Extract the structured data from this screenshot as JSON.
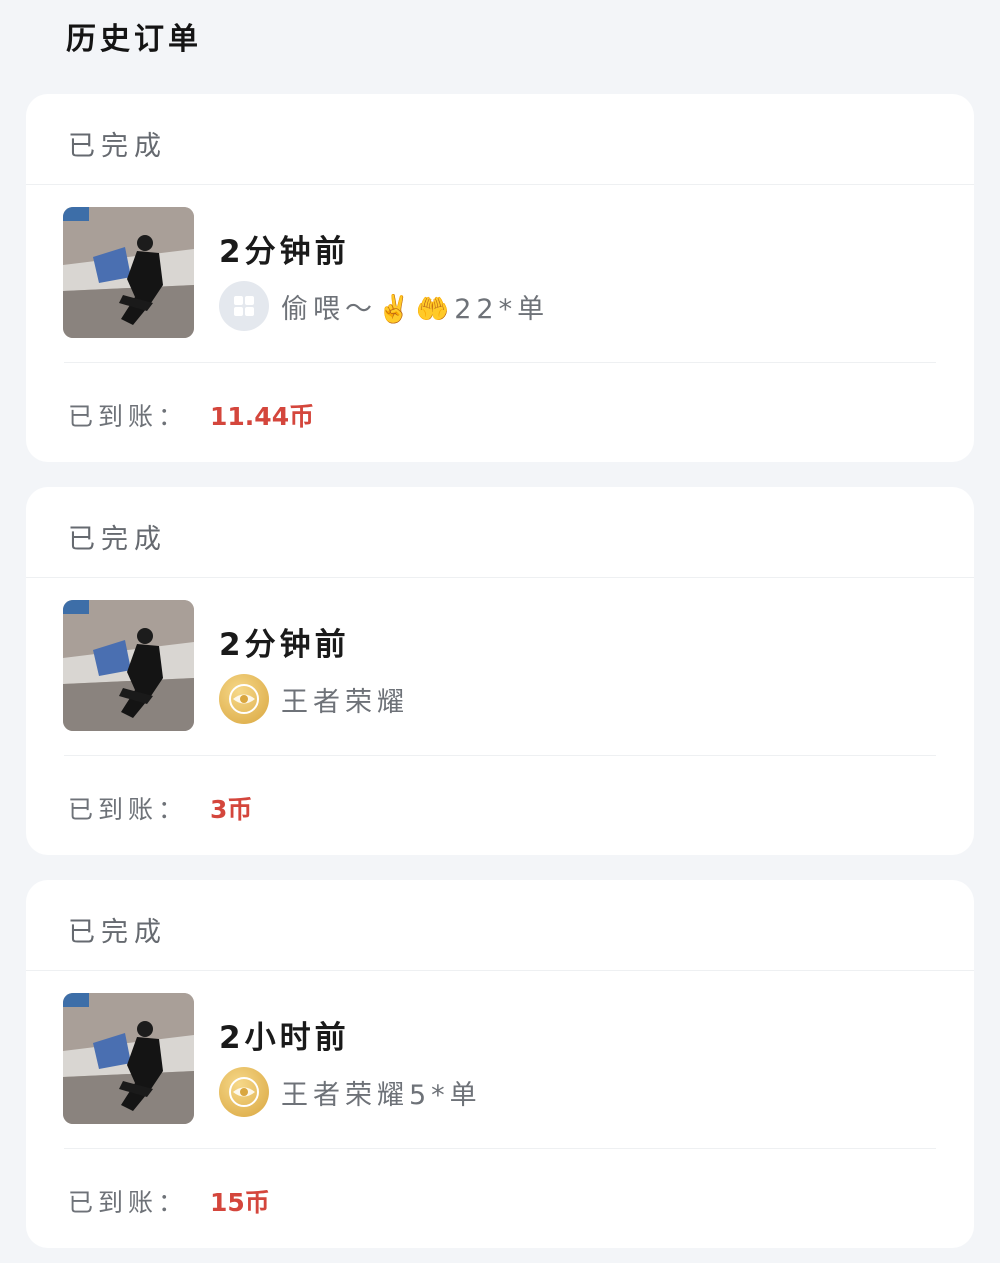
{
  "page": {
    "title": "历史订单"
  },
  "orders": [
    {
      "status": "已完成",
      "time": "2分钟前",
      "game": "偷喂～✌️🤲22*单",
      "game_icon": "grid-circle-icon",
      "paid_label": "已到账：",
      "amount": "11.44币"
    },
    {
      "status": "已完成",
      "time": "2分钟前",
      "game": "王者荣耀",
      "game_icon": "honor-of-kings-icon",
      "paid_label": "已到账：",
      "amount": "3币"
    },
    {
      "status": "已完成",
      "time": "2小时前",
      "game": "王者荣耀5*单",
      "game_icon": "honor-of-kings-icon",
      "paid_label": "已到账：",
      "amount": "15币"
    }
  ],
  "colors": {
    "amount": "#d4463c",
    "background": "#f3f5f8",
    "card": "#ffffff"
  }
}
